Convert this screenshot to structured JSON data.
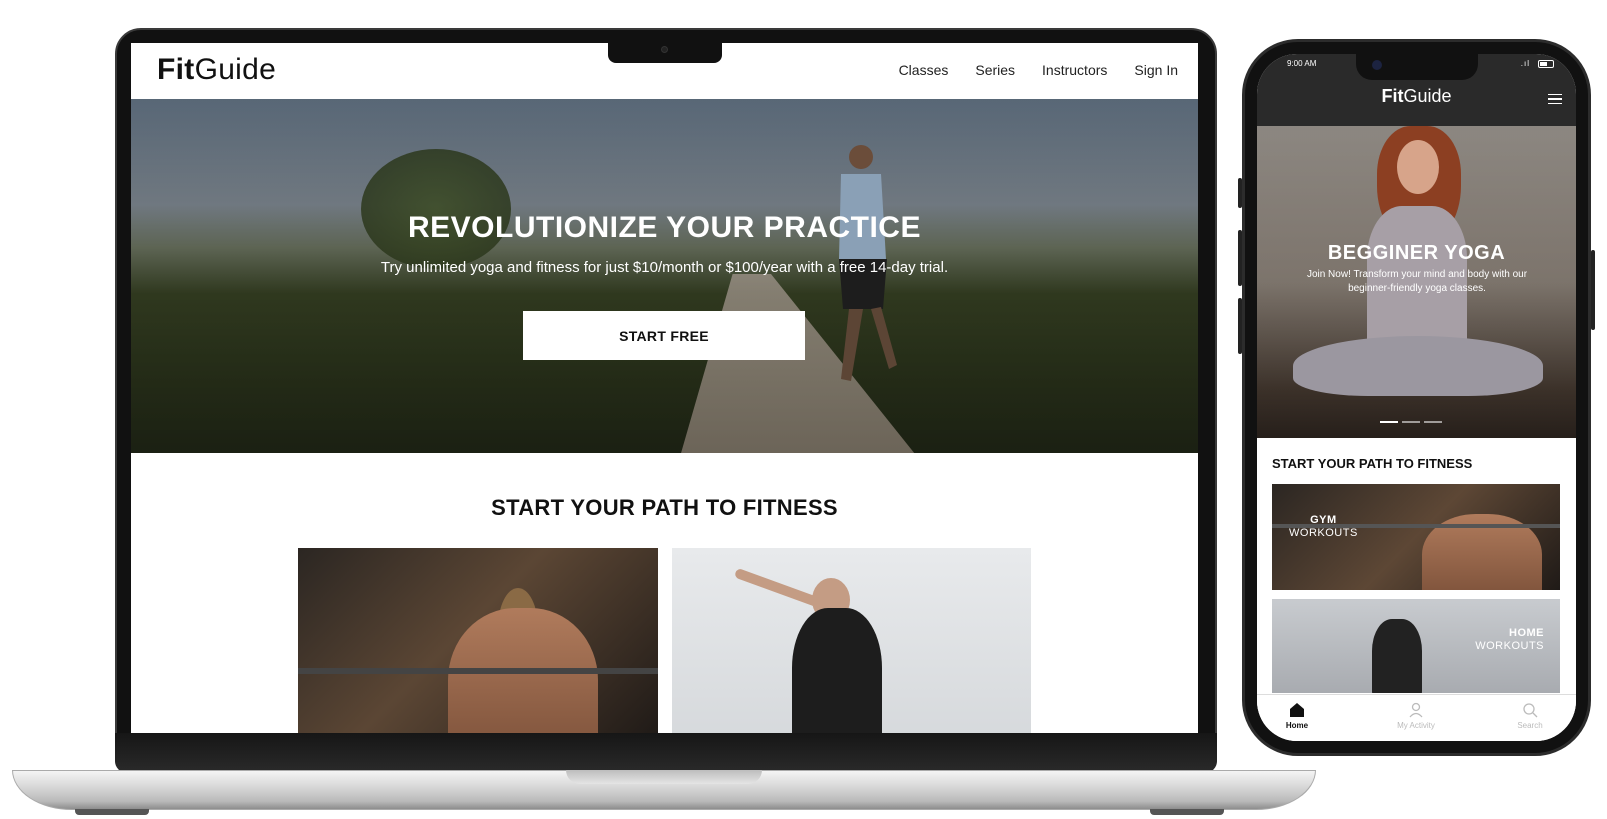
{
  "desktop": {
    "brand": {
      "bold": "Fit",
      "light": "Guide"
    },
    "nav": [
      "Classes",
      "Series",
      "Instructors",
      "Sign In"
    ],
    "hero": {
      "title": "REVOLUTIONIZE YOUR PRACTICE",
      "subtitle": "Try unlimited yoga and fitness for just $10/month or $100/year with a free 14-day trial.",
      "cta": "START FREE"
    },
    "section_title": "START YOUR PATH TO FITNESS"
  },
  "mobile": {
    "status": {
      "time": "9:00 AM",
      "signal": ".ıl"
    },
    "brand": {
      "bold": "Fit",
      "light": "Guide"
    },
    "hero": {
      "title": "BEGGINER YOGA",
      "subtitle": "Join Now! Transform your mind and body with our beginner-friendly yoga classes."
    },
    "section_title": "START YOUR PATH TO FITNESS",
    "cards": [
      {
        "line1": "GYM",
        "line2": "WORKOUTS"
      },
      {
        "line1": "HOME",
        "line2": "WORKOUTS"
      }
    ],
    "tabs": [
      "Home",
      "My Activity",
      "Search"
    ]
  },
  "colors": {
    "dark": "#2a2a2a",
    "white": "#ffffff",
    "text": "#111111"
  },
  "icons": [
    "menu-icon",
    "home-icon",
    "user-icon",
    "search-icon",
    "battery-icon"
  ]
}
